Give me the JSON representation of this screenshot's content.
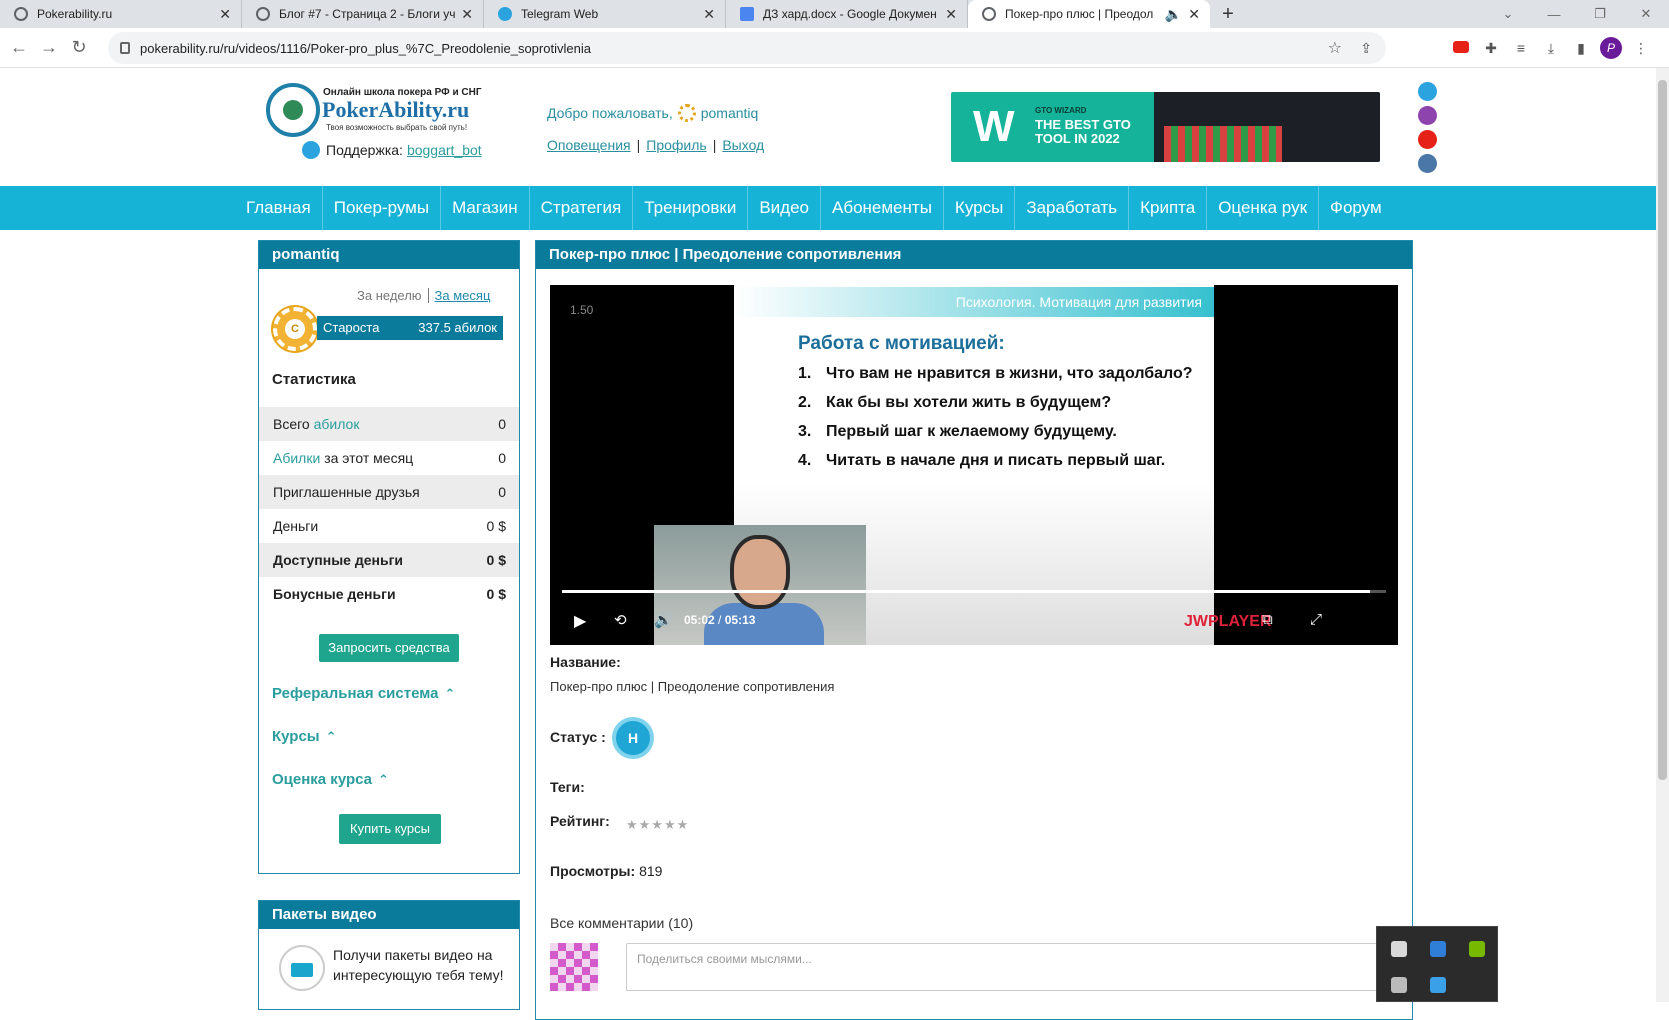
{
  "browser": {
    "tabs": [
      {
        "title": "Pokerability.ru",
        "icon": "globe-icon"
      },
      {
        "title": "Блог #7 - Страница 2 - Блоги уч",
        "icon": "globe-icon"
      },
      {
        "title": "Telegram Web",
        "icon": "telegram-icon"
      },
      {
        "title": "ДЗ хард.docx - Google Докумен",
        "icon": "docs-icon"
      },
      {
        "title": "Покер-про плюс | Преодол",
        "icon": "globe-icon"
      }
    ],
    "url": "pokerability.ru/ru/videos/1116/Poker-pro_plus_%7C_Preodolenie_soprotivlenia",
    "profile_initial": "P"
  },
  "header": {
    "logo_tagline_top": "Онлайн школа покера РФ и СНГ",
    "logo_brand": "PokerAbility.ru",
    "logo_tagline_bottom": "Твоя возможность выбрать свой путь!",
    "support_label": "Поддержка:",
    "support_link": "boggart_bot",
    "welcome_text": "Добро пожаловать,",
    "username": "pomantiq",
    "links": {
      "notifications": "Оповещения",
      "profile": "Профиль",
      "logout": "Выход"
    },
    "banner": {
      "small": "GTO WIZARD",
      "line1": "THE BEST GTO",
      "line2": "TOOL IN 2022",
      "letter": "W"
    }
  },
  "nav": [
    "Главная",
    "Покер-румы",
    "Магазин",
    "Стратегия",
    "Тренировки",
    "Видео",
    "Абонементы",
    "Курсы",
    "Заработать",
    "Крипта",
    "Оценка рук",
    "Форум"
  ],
  "sidebar": {
    "title": "pomantiq",
    "period_week": "За неделю",
    "period_month": "За месяц",
    "rank_letter": "C",
    "rank_name": "Староста",
    "rank_value": "337.5 абилок",
    "stats_title": "Статистика",
    "stats": {
      "total_prefix": "Всего",
      "total_link": "абилок",
      "total_value": "0",
      "month_link": "Абилки",
      "month_suffix": "за этот месяц",
      "month_value": "0",
      "friends_label": "Приглашенные друзья",
      "friends_value": "0",
      "money_label": "Деньги",
      "money_value": "0 $",
      "available_label": "Доступные деньги",
      "available_value": "0 $",
      "bonus_label": "Бонусные деньги",
      "bonus_value": "0 $"
    },
    "request_button": "Запросить средства",
    "referral": "Реферальная система",
    "courses": "Курсы",
    "course_rating": "Оценка курса",
    "buy_button": "Купить курсы",
    "packages_title": "Пакеты видео",
    "packages_text": "Получи пакеты видео на интересующую тебя тему!"
  },
  "main": {
    "title": "Покер-про плюс | Преодоление сопротивления",
    "video": {
      "speed": "1.50",
      "slide_strip": "Психология. Мотивация для развития",
      "slide_heading": "Работа с мотивацией:",
      "slide_items": [
        "Что вам не нравится в жизни, что задолбало?",
        "Как бы вы хотели жить в будущем?",
        "Первый шаг к желаемому будущему.",
        "Читать в начале дня и писать первый шаг."
      ],
      "current_time": "05:02",
      "duration": "05:13",
      "progress": 0.98,
      "player_brand": "JWPLAYER"
    },
    "name_label": "Название:",
    "name_value": "Покер-про плюс | Преодоление сопротивления",
    "status_label": "Статус :",
    "status_badge": "Н",
    "tags_label": "Теги:",
    "rating_label": "Рейтинг:",
    "rating_stars": "★★★★★",
    "rating_value": 0,
    "views_label": "Просмотры:",
    "views_value": "819",
    "comments_title": "Все комментарии (10)",
    "comment_placeholder": "Поделиться своими мыслями..."
  }
}
